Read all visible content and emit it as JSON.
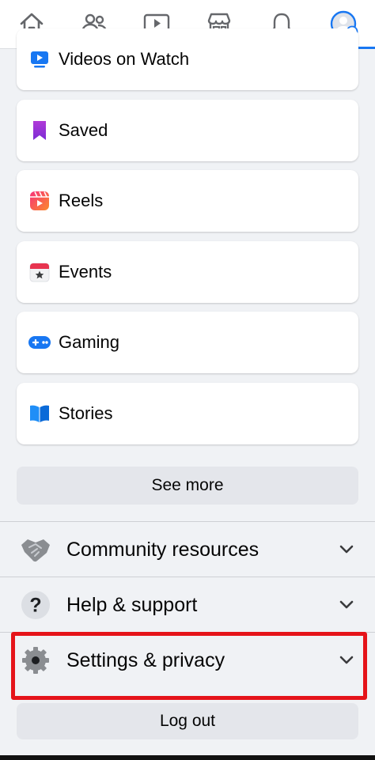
{
  "nav": {
    "tabs": [
      {
        "icon": "home-icon"
      },
      {
        "icon": "friends-icon"
      },
      {
        "icon": "watch-icon"
      },
      {
        "icon": "marketplace-icon"
      },
      {
        "icon": "notifications-icon"
      },
      {
        "icon": "profile-menu-icon",
        "active": true
      }
    ],
    "accent": "#1877f2"
  },
  "shortcuts": [
    {
      "label": "Videos on Watch",
      "icon": "watch-video-icon"
    },
    {
      "label": "Saved",
      "icon": "saved-bookmark-icon"
    },
    {
      "label": "Reels",
      "icon": "reels-icon"
    },
    {
      "label": "Events",
      "icon": "events-calendar-icon"
    },
    {
      "label": "Gaming",
      "icon": "gaming-controller-icon"
    },
    {
      "label": "Stories",
      "icon": "stories-book-icon"
    }
  ],
  "see_more_label": "See more",
  "sections": [
    {
      "label": "Community resources",
      "icon": "handshake-icon"
    },
    {
      "label": "Help & support",
      "icon": "help-question-icon"
    },
    {
      "label": "Settings & privacy",
      "icon": "settings-gear-icon"
    }
  ],
  "logout_label": "Log out",
  "highlight_color": "#e5141a"
}
